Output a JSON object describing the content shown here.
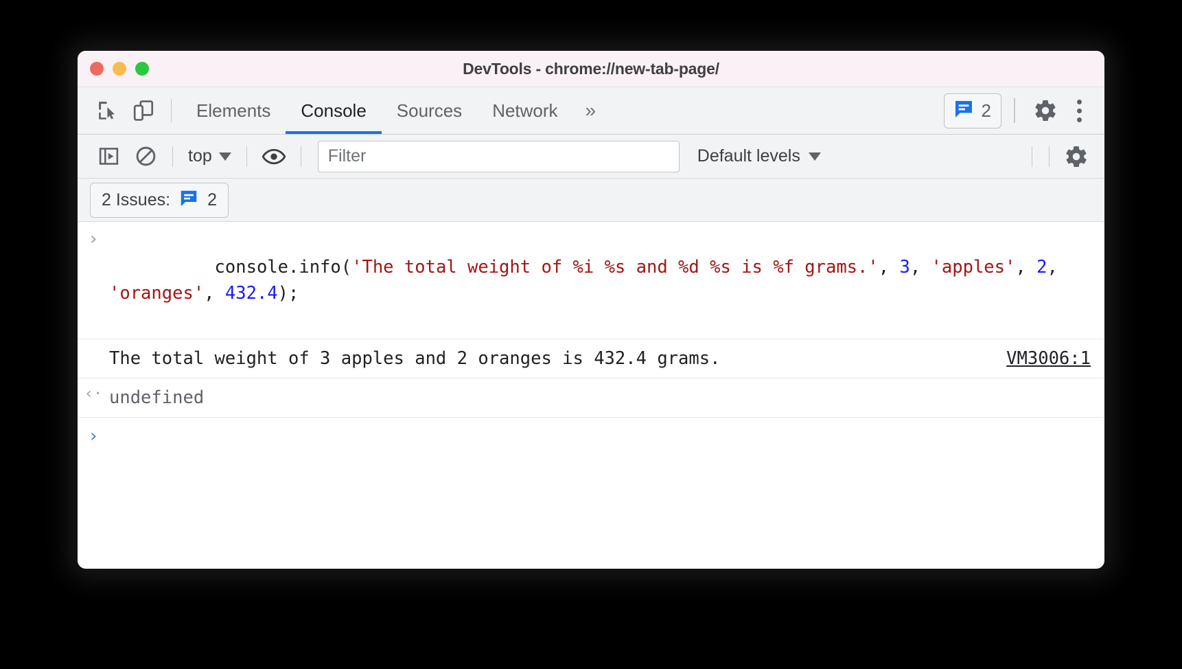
{
  "window": {
    "title": "DevTools - chrome://new-tab-page/",
    "traffic": {
      "close": "close-window",
      "minimize": "minimize-window",
      "zoom": "zoom-window"
    }
  },
  "tabbar": {
    "inspect_icon": "inspect-element-icon",
    "device_icon": "device-toolbar-icon",
    "tabs": [
      {
        "label": "Elements",
        "active": false
      },
      {
        "label": "Console",
        "active": true
      },
      {
        "label": "Sources",
        "active": false
      },
      {
        "label": "Network",
        "active": false
      }
    ],
    "more_tabs": "»",
    "issues_badge": {
      "icon": "issues-message-icon",
      "count": "2"
    },
    "settings_icon": "gear-icon",
    "menu_icon": "kebab-menu-icon",
    "accent": "#1a73e8"
  },
  "console_toolbar": {
    "sidebar_icon": "console-sidebar-icon",
    "clear_icon": "clear-console-icon",
    "context": {
      "label": "top",
      "caret": "chevron-down-icon"
    },
    "eye_icon": "live-expression-eye-icon",
    "filter": {
      "placeholder": "Filter",
      "value": ""
    },
    "levels": {
      "label": "Default levels",
      "caret": "chevron-down-icon"
    },
    "settings_icon": "gear-icon"
  },
  "issues_bar": {
    "label": "2 Issues:",
    "icon": "issues-message-icon",
    "count": "2"
  },
  "console": {
    "messages": [
      {
        "type": "input",
        "gutter": "›",
        "tokens": [
          {
            "t": "console.info(",
            "c": "plain"
          },
          {
            "t": "'The total weight of %i %s and %d %s is %f grams.'",
            "c": "str"
          },
          {
            "t": ", ",
            "c": "plain"
          },
          {
            "t": "3",
            "c": "num"
          },
          {
            "t": ", ",
            "c": "plain"
          },
          {
            "t": "'apples'",
            "c": "str"
          },
          {
            "t": ", ",
            "c": "plain"
          },
          {
            "t": "2",
            "c": "num"
          },
          {
            "t": ", ",
            "c": "plain"
          },
          {
            "t": "'oranges'",
            "c": "str"
          },
          {
            "t": ", ",
            "c": "plain"
          },
          {
            "t": "432.4",
            "c": "num"
          },
          {
            "t": ");",
            "c": "plain"
          }
        ]
      },
      {
        "type": "output",
        "gutter": "",
        "text": "The total weight of 3 apples and 2 oranges is 432.4 grams.",
        "source": "VM3006:1"
      },
      {
        "type": "result",
        "gutter": "‹·",
        "text": "undefined"
      }
    ],
    "prompt": "›"
  }
}
